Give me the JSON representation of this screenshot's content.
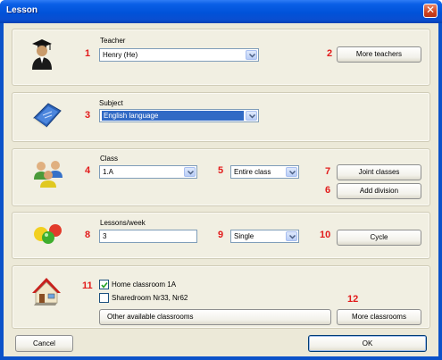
{
  "window": {
    "title": "Lesson"
  },
  "teacher": {
    "number": "1",
    "label": "Teacher",
    "value": "Henry (He)",
    "more_number": "2",
    "more_label": "More teachers"
  },
  "subject": {
    "number": "3",
    "label": "Subject",
    "value": "English language"
  },
  "class": {
    "number": "4",
    "label": "Class",
    "value": "1.A",
    "scope_number": "5",
    "scope_value": "Entire class",
    "joint_number": "7",
    "joint_label": "Joint classes",
    "division_number": "6",
    "division_label": "Add division"
  },
  "lessons": {
    "number": "8",
    "label": "Lessons/week",
    "value": "3",
    "length_number": "9",
    "length_value": "Single",
    "cycle_number": "10",
    "cycle_label": "Cycle"
  },
  "classrooms": {
    "number": "11",
    "home": {
      "label": "Home classroom 1A",
      "checked": true
    },
    "shared": {
      "label": "Sharedroom Nr33, Nr62",
      "checked": false
    },
    "other_label": "Other available classrooms",
    "more_number": "12",
    "more_label": "More classrooms"
  },
  "footer": {
    "cancel_label": "Cancel",
    "ok_label": "OK"
  },
  "icons": {
    "teacher": "teacher-icon",
    "subject": "book-icon",
    "class": "students-icon",
    "lessons": "balls-icon",
    "classroom": "house-icon",
    "close": "close-icon",
    "dropdown": "chevron-down-icon",
    "check": "checkmark-icon"
  }
}
